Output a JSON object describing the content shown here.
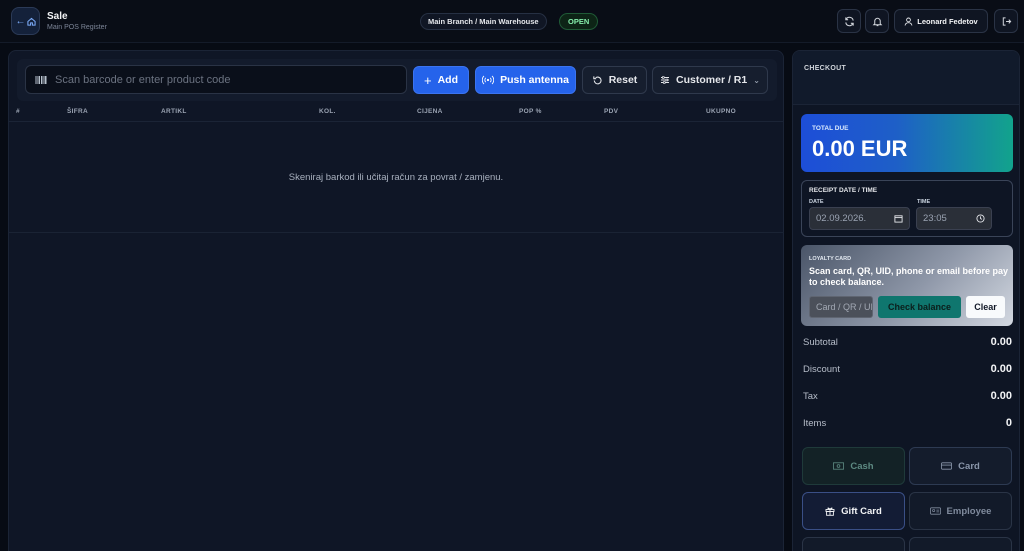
{
  "header": {
    "title": "Sale",
    "subtitle": "Main POS Register",
    "branch": "Main Branch / Main Warehouse",
    "status": "OPEN",
    "user_name": "Leonard Fedetov"
  },
  "toolbar": {
    "search_placeholder": "Scan barcode or enter product code",
    "add_label": "Add",
    "push_label": "Push antenna",
    "reset_label": "Reset",
    "customer_label": "Customer / R1"
  },
  "table": {
    "columns": [
      "#",
      "ŠIFRA",
      "ARTIKL",
      "KOL.",
      "CIJENA",
      "POP %",
      "PDV",
      "UKUPNO"
    ],
    "empty_message": "Skeniraj barkod ili učitaj račun za povrat / zamjenu."
  },
  "checkout": {
    "title": "CHECKOUT",
    "total_label": "TOTAL DUE",
    "total_value": "0.00 EUR",
    "receipt_label": "RECEIPT DATE / TIME",
    "date_label": "DATE",
    "date_value": "02.09.2026.",
    "time_label": "TIME",
    "time_value": "23:05",
    "loyalty_label": "LOYALTY CARD",
    "loyalty_text": "Scan card, QR, UID, phone or email before pay to check balance.",
    "loyalty_placeholder": "Card / QR / UID",
    "check_label": "Check balance",
    "clear_label": "Clear",
    "summary": [
      {
        "label": "Subtotal",
        "value": "0.00"
      },
      {
        "label": "Discount",
        "value": "0.00"
      },
      {
        "label": "Tax",
        "value": "0.00"
      },
      {
        "label": "Items",
        "value": "0"
      }
    ],
    "payments": {
      "cash": "Cash",
      "card": "Card",
      "gift_card": "Gift Card",
      "employee": "Employee"
    }
  },
  "colors": {
    "primary": "#2563eb",
    "open_status": "#86efac",
    "teal": "#0f766e"
  }
}
